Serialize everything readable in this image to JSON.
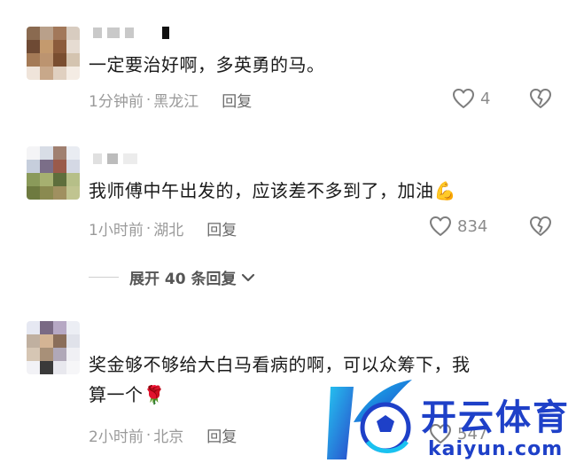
{
  "comments": [
    {
      "text": "一定要治好啊，多英勇的马。",
      "time": "1分钟前",
      "sep": "·",
      "location": "黑龙江",
      "reply": "回复",
      "likes": "4"
    },
    {
      "text": "我师傅中午出发的，应该差不多到了，加油",
      "emoji": "💪",
      "time": "1小时前",
      "sep": "·",
      "location": "湖北",
      "reply": "回复",
      "likes": "834"
    },
    {
      "text_line1": "奖金够不够给大白马看病的啊，可以众筹下，我",
      "text_line2": "算一个",
      "emoji": "🌹",
      "time": "2小时前",
      "sep": "·",
      "location": "北京",
      "reply": "回复",
      "likes": "547"
    }
  ],
  "expand_replies": "展开 40 条回复",
  "watermark": {
    "title": "开云体育",
    "subtitle": "kaiyun.com"
  },
  "colors": {
    "text": "#1a1a1a",
    "meta": "#9a9a9a",
    "brand": "#1e40c8"
  },
  "icons": [
    "heart-outline-icon",
    "broken-heart-icon",
    "chevron-down-icon"
  ]
}
